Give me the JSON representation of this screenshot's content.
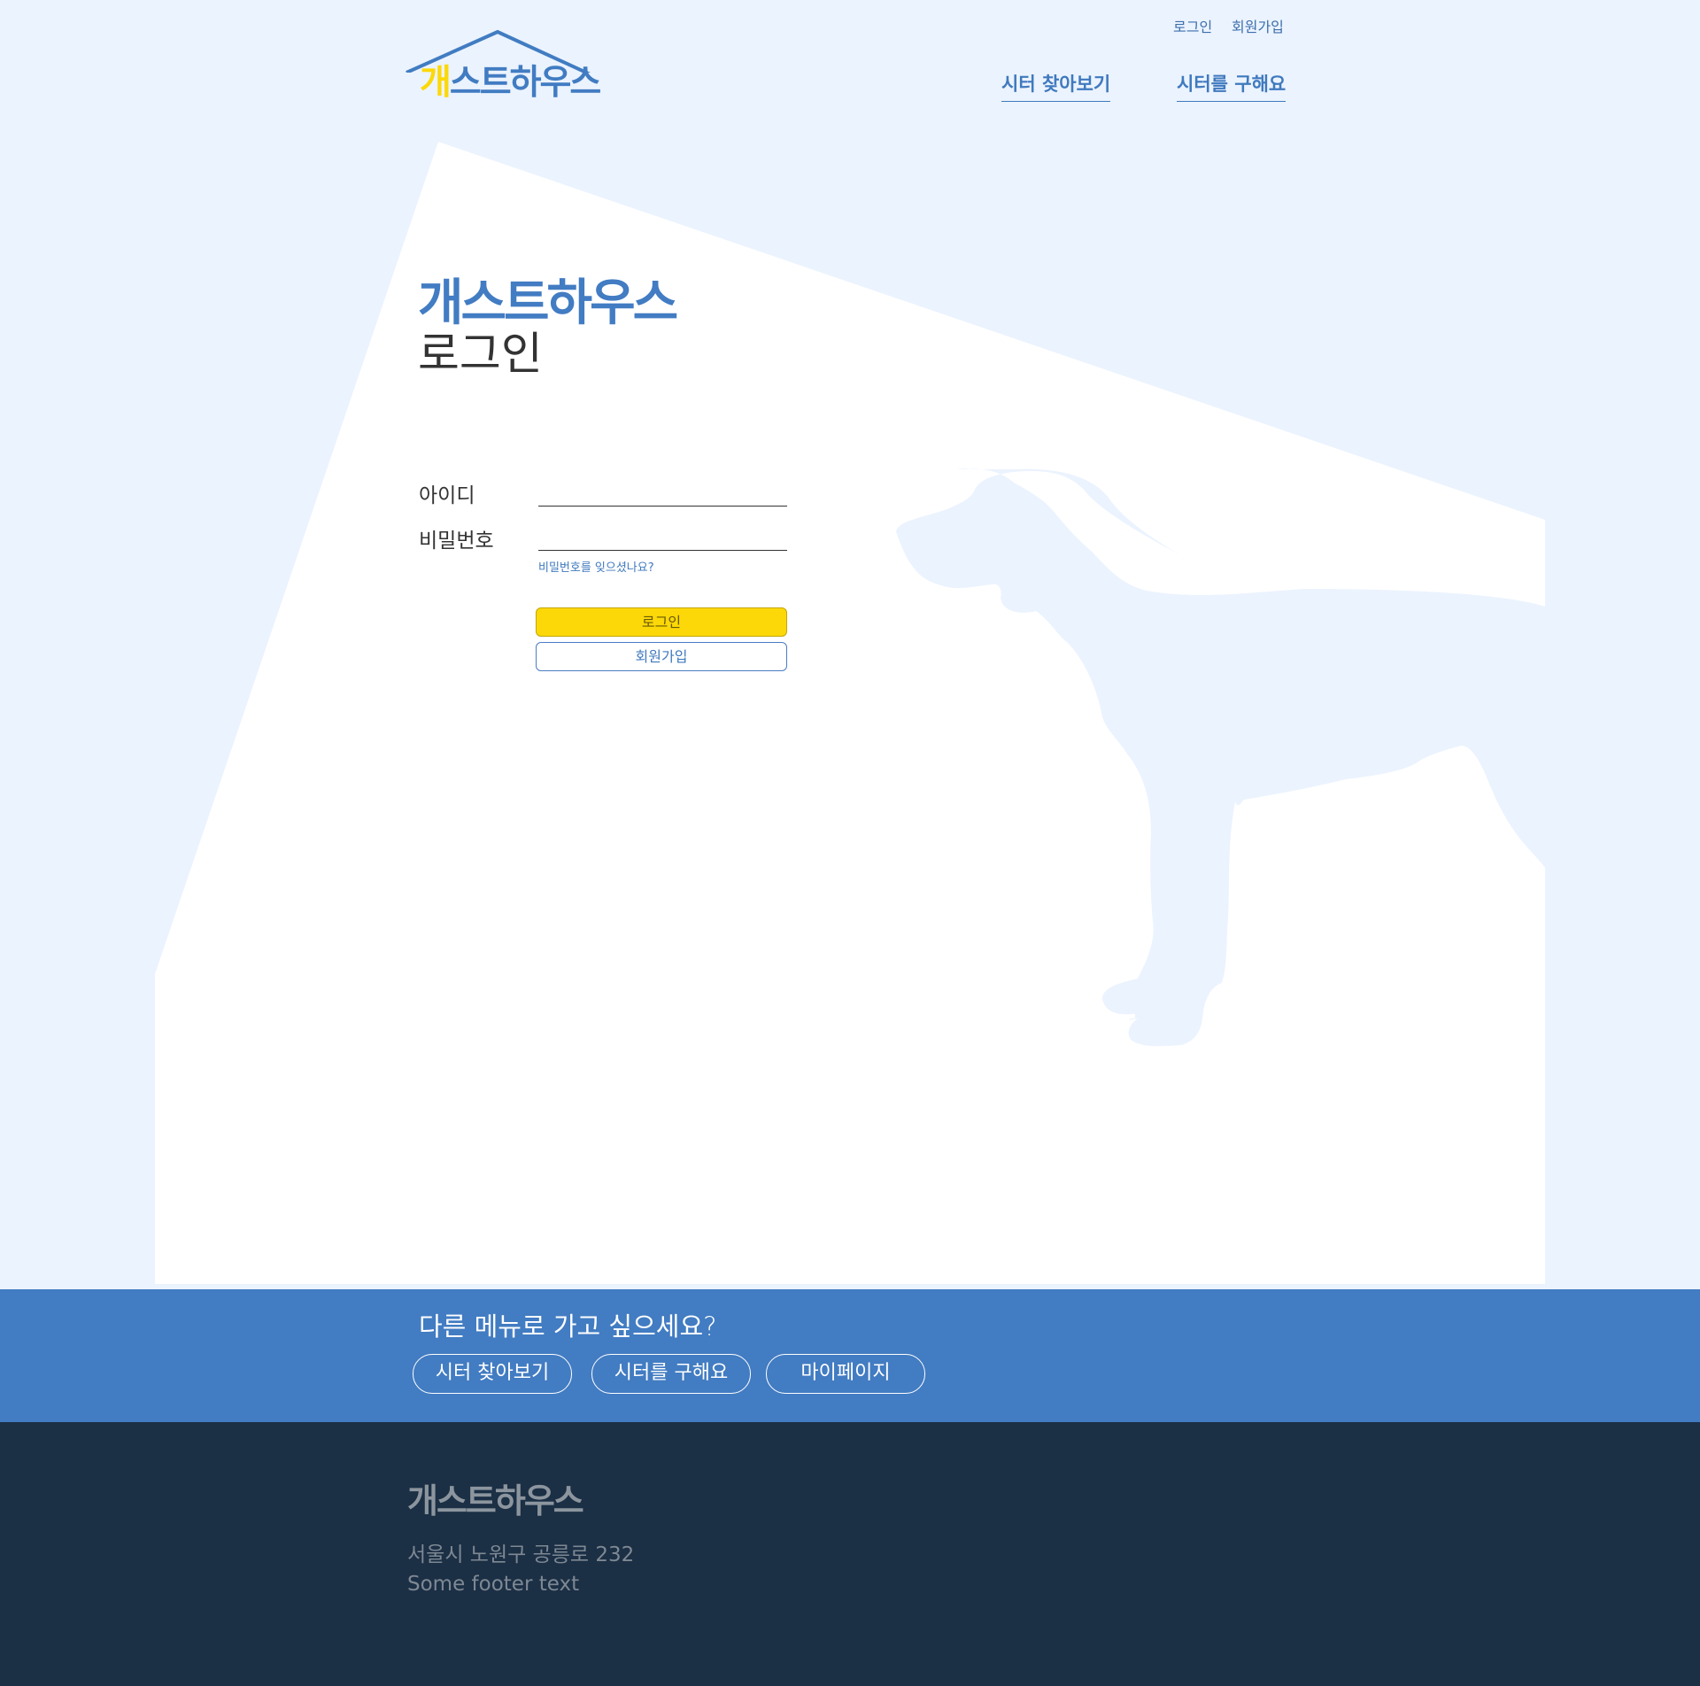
{
  "header": {
    "logo_text": {
      "first": "개",
      "rest": "스트하우스"
    },
    "util_links": {
      "login": "로그인",
      "signup": "회원가입"
    },
    "nav": {
      "find_sitter": "시터 찾아보기",
      "request_sitter": "시터를 구해요"
    }
  },
  "hero": {
    "brand": "개스트하우스",
    "title": "로그인"
  },
  "form": {
    "id_label": "아이디",
    "id_value": "",
    "password_label": "비밀번호",
    "password_value": "",
    "forgot_password": "비밀번호를 잊으셨나요?",
    "login_button": "로그인",
    "signup_button": "회원가입"
  },
  "menu_band": {
    "title": "다른 메뉴로 가고 싶으세요?",
    "buttons": [
      "시터 찾아보기",
      "시터를 구해요",
      "마이페이지"
    ]
  },
  "footer": {
    "brand": "개스트하우스",
    "address": "서울시 노원구 공릉로 232",
    "text": "Some footer text"
  },
  "colors": {
    "page_bg": "#ebf3fe",
    "card_bg": "#ffffff",
    "brand_blue": "#427cc2",
    "accent_yellow": "#fcd808",
    "footer_bg": "#1b2f45"
  }
}
